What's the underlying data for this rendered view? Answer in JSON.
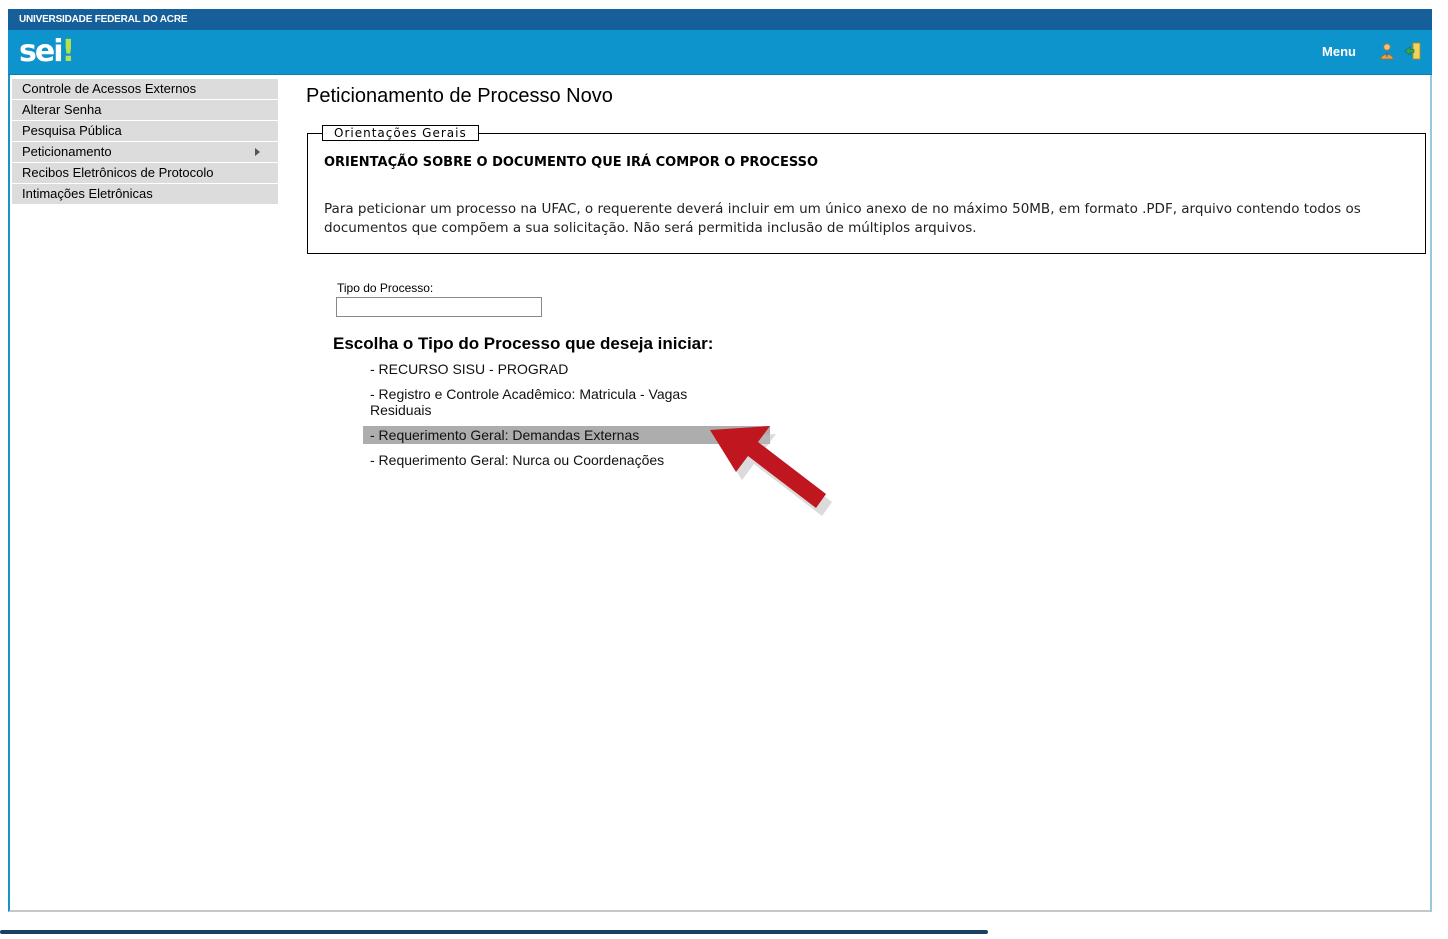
{
  "topbar": {
    "org": "UNIVERSIDADE FEDERAL DO ACRE"
  },
  "header": {
    "logo_text": "sei",
    "logo_mark": "!",
    "menu_label": "Menu",
    "icons": [
      "user-icon",
      "exit-icon"
    ]
  },
  "sidebar": {
    "items": [
      {
        "label": "Controle de Acessos Externos"
      },
      {
        "label": "Alterar Senha"
      },
      {
        "label": "Pesquisa Pública"
      },
      {
        "label": "Peticionamento",
        "has_submenu": true
      },
      {
        "label": "Recibos Eletrônicos de Protocolo"
      },
      {
        "label": "Intimações Eletrônicas"
      }
    ]
  },
  "main": {
    "title": "Peticionamento de Processo Novo",
    "orientacoes": {
      "legend": "Orientações Gerais",
      "heading": "ORIENTAÇÃO SOBRE O DOCUMENTO QUE IRÁ COMPOR O PROCESSO",
      "body": "Para peticionar um processo na UFAC, o requerente deverá incluir em um único anexo de no máximo 50MB, em formato .PDF, arquivo contendo todos os documentos que compõem a sua solicitação. Não será permitida inclusão de múltiplos arquivos."
    },
    "tipo_label": "Tipo do Processo:",
    "tipo_value": "",
    "escolha_label": "Escolha o Tipo do Processo que deseja iniciar:",
    "processos": [
      {
        "label": "- RECURSO SISU - PROGRAD",
        "highlighted": false
      },
      {
        "label": "- Registro e Controle Acadêmico: Matricula - Vagas Residuais",
        "highlighted": false
      },
      {
        "label": "- Requerimento Geral: Demandas Externas",
        "highlighted": true
      },
      {
        "label": "- Requerimento Geral: Nurca ou Coordenações",
        "highlighted": false
      }
    ]
  },
  "colors": {
    "topbar": "#155f9a",
    "header": "#0d94cc",
    "logo_accent": "#b7e04a",
    "sidebar_item": "#dcdcdc",
    "highlight": "#adadad",
    "arrow": "#c0161f"
  }
}
